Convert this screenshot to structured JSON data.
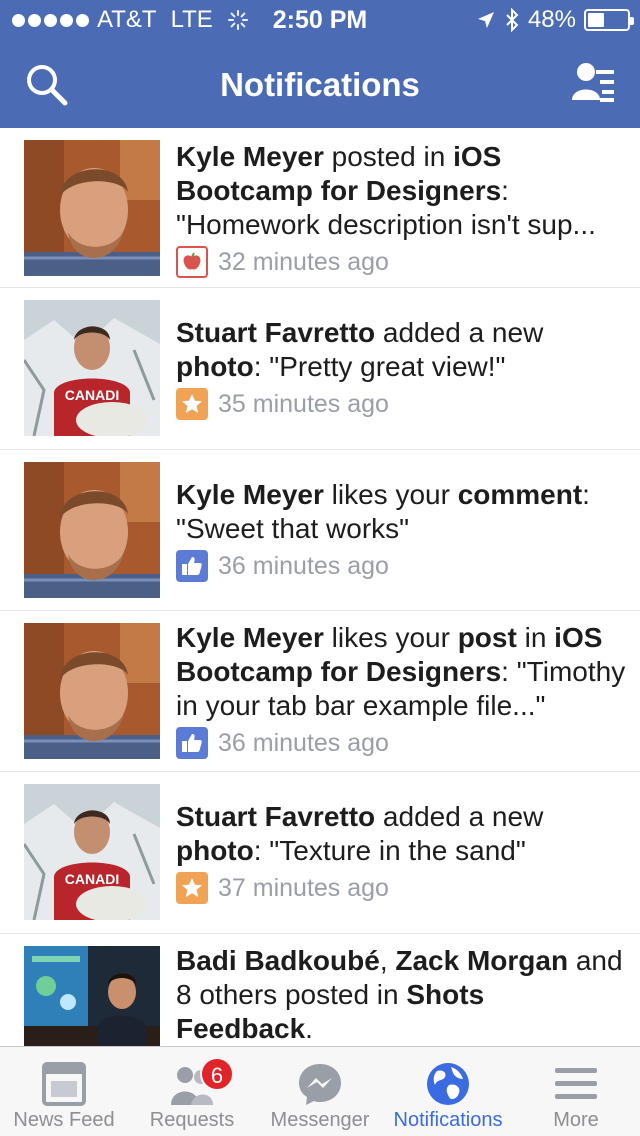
{
  "status_bar": {
    "carrier": "AT&T",
    "network": "LTE",
    "time": "2:50 PM",
    "battery": "48%",
    "battery_level": 0.48
  },
  "nav": {
    "title": "Notifications"
  },
  "notifications": [
    {
      "actor": "Kyle Meyer",
      "t1": " posted in ",
      "obj": "iOS Bootcamp for Designers",
      "t2": ": \"Homework description isn't sup...",
      "icon": "group-icon",
      "time": "32 minutes ago"
    },
    {
      "actor": "Stuart Favretto",
      "t1": " added a new ",
      "obj": "photo",
      "t2": ": \"Pretty great view!\"",
      "icon": "photo-star-icon",
      "time": "35 minutes ago"
    },
    {
      "actor": "Kyle Meyer",
      "t1": " likes your ",
      "obj": "comment",
      "t2": ": \"Sweet that works\"",
      "icon": "like-icon",
      "time": "36 minutes ago"
    },
    {
      "actor": "Kyle Meyer",
      "t1": " likes your ",
      "obj": "post",
      "t2": " in ",
      "obj2": "iOS Bootcamp for Designers",
      "t3": ": \"Timothy in your tab bar example file...\"",
      "icon": "like-icon",
      "time": "36 minutes ago"
    },
    {
      "actor": "Stuart Favretto",
      "t1": " added a new ",
      "obj": "photo",
      "t2": ": \"Texture in the sand\"",
      "icon": "photo-star-icon",
      "time": "37 minutes ago"
    },
    {
      "actor": "Badi Badkoubé",
      "t1": ", ",
      "obj": "Zack Morgan",
      "t2": " and 8 others posted in ",
      "obj2": "Shots Feedback",
      "t3": "."
    }
  ],
  "tabs": [
    {
      "label": "News Feed",
      "icon": "news-feed-icon"
    },
    {
      "label": "Requests",
      "icon": "requests-icon",
      "badge": "6"
    },
    {
      "label": "Messenger",
      "icon": "messenger-icon"
    },
    {
      "label": "Notifications",
      "icon": "globe-icon",
      "active": true
    },
    {
      "label": "More",
      "icon": "menu-icon"
    }
  ],
  "colors": {
    "brand_blue": "#4b6cb4",
    "active_tab": "#3b6be0",
    "badge_red": "#e0242a",
    "timestamp_gray": "#9a9ea6"
  }
}
